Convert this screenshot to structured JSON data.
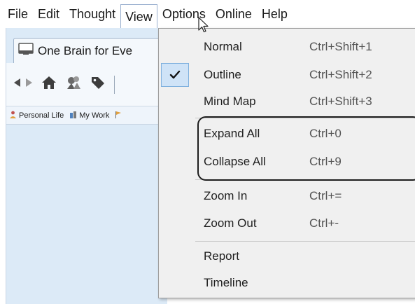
{
  "menubar": {
    "items": [
      "File",
      "Edit",
      "Thought",
      "View",
      "Options",
      "Online",
      "Help"
    ],
    "active_index": 3
  },
  "tab": {
    "label": "One Brain for Eve"
  },
  "favorites": [
    {
      "label": "Personal Life"
    },
    {
      "label": "My Work"
    }
  ],
  "view_menu": {
    "items": [
      {
        "label": "Normal",
        "shortcut": "Ctrl+Shift+1",
        "checked": false
      },
      {
        "label": "Outline",
        "shortcut": "Ctrl+Shift+2",
        "checked": true
      },
      {
        "label": "Mind Map",
        "shortcut": "Ctrl+Shift+3",
        "checked": false
      },
      {
        "label": "Expand All",
        "shortcut": "Ctrl+0",
        "checked": false
      },
      {
        "label": "Collapse All",
        "shortcut": "Ctrl+9",
        "checked": false
      },
      {
        "label": "Zoom In",
        "shortcut": "Ctrl+=",
        "checked": false
      },
      {
        "label": "Zoom Out",
        "shortcut": "Ctrl+-",
        "checked": false
      },
      {
        "label": "Report",
        "shortcut": "",
        "checked": false
      },
      {
        "label": "Timeline",
        "shortcut": "",
        "checked": false
      }
    ]
  },
  "colors": {
    "app_background": "#dceaf7",
    "menu_background": "#f0f0f0",
    "check_highlight": "#cfe3f7",
    "annotation_border": "#1e1e1e"
  }
}
